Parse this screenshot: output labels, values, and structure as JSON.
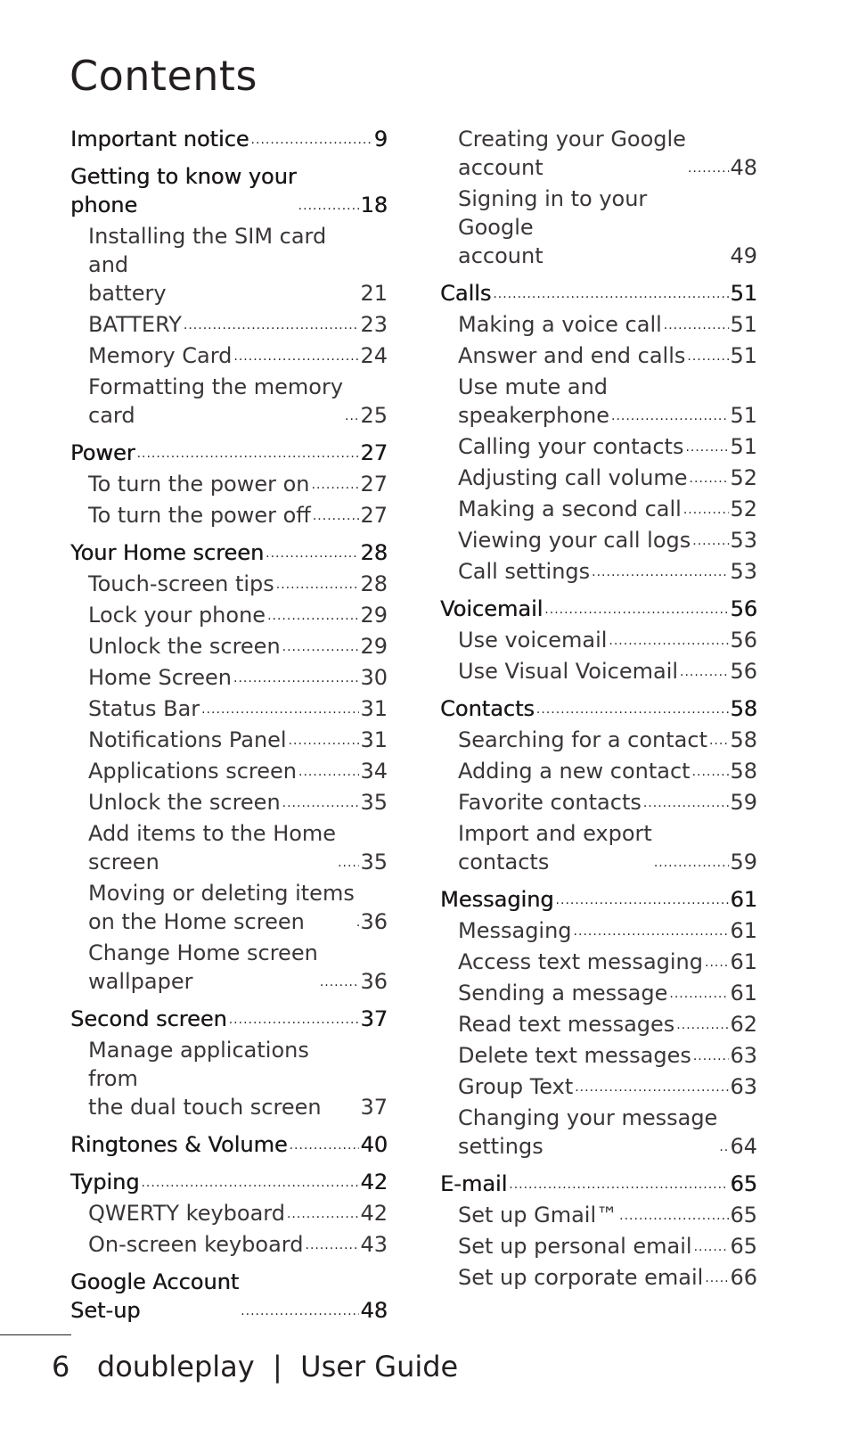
{
  "title": "Contents",
  "left_column": [
    {
      "level": "section",
      "text": "Important notice",
      "page": "9"
    },
    {
      "level": "section",
      "text": "Getting to know your\nphone",
      "page": "18"
    },
    {
      "level": "sub",
      "text": "Installing the SIM card and\nbattery",
      "page": "21"
    },
    {
      "level": "sub",
      "text": "BATTERY",
      "page": "23"
    },
    {
      "level": "sub",
      "text": "Memory Card",
      "page": "24"
    },
    {
      "level": "sub",
      "text": "Formatting the memory\ncard",
      "page": "25"
    },
    {
      "level": "section",
      "text": "Power",
      "page": "27"
    },
    {
      "level": "sub",
      "text": "To turn the power on",
      "page": "27"
    },
    {
      "level": "sub",
      "text": "To turn the power off",
      "page": "27"
    },
    {
      "level": "section",
      "text": "Your Home screen",
      "page": "28"
    },
    {
      "level": "sub",
      "text": "Touch-screen tips",
      "page": "28"
    },
    {
      "level": "sub",
      "text": "Lock your phone",
      "page": "29"
    },
    {
      "level": "sub",
      "text": "Unlock the screen",
      "page": "29"
    },
    {
      "level": "sub",
      "text": "Home Screen",
      "page": "30"
    },
    {
      "level": "sub",
      "text": "Status Bar",
      "page": "31"
    },
    {
      "level": "sub",
      "text": "Notifications Panel",
      "page": "31"
    },
    {
      "level": "sub",
      "text": "Applications screen",
      "page": "34"
    },
    {
      "level": "sub",
      "text": "Unlock the screen",
      "page": "35"
    },
    {
      "level": "sub",
      "text": "Add items to the Home\nscreen",
      "page": "35"
    },
    {
      "level": "sub",
      "text": "Moving or deleting items\non the Home screen",
      "page": "36"
    },
    {
      "level": "sub",
      "text": "Change Home screen\nwallpaper",
      "page": "36"
    },
    {
      "level": "section",
      "text": "Second screen",
      "page": "37"
    },
    {
      "level": "sub",
      "text": "Manage applications from\nthe dual touch screen",
      "page": "37"
    },
    {
      "level": "section",
      "text": "Ringtones & Volume",
      "page": "40"
    },
    {
      "level": "section",
      "text": "Typing",
      "page": "42"
    },
    {
      "level": "sub",
      "text": "QWERTY keyboard",
      "page": "42"
    },
    {
      "level": "sub",
      "text": "On-screen keyboard",
      "page": "43"
    },
    {
      "level": "section",
      "text": "Google Account\nSet-up",
      "page": "48"
    }
  ],
  "right_column": [
    {
      "level": "sub",
      "text": "Creating your Google\naccount",
      "page": "48"
    },
    {
      "level": "sub",
      "text": "Signing in to your Google\naccount",
      "page": "49"
    },
    {
      "level": "section",
      "text": "Calls",
      "page": "51"
    },
    {
      "level": "sub",
      "text": "Making a voice call",
      "page": "51"
    },
    {
      "level": "sub",
      "text": "Answer and end calls",
      "page": "51"
    },
    {
      "level": "sub",
      "text": "Use mute and\nspeakerphone",
      "page": "51"
    },
    {
      "level": "sub",
      "text": "Calling your contacts",
      "page": "51"
    },
    {
      "level": "sub",
      "text": "Adjusting call volume",
      "page": "52"
    },
    {
      "level": "sub",
      "text": "Making a second call",
      "page": "52"
    },
    {
      "level": "sub",
      "text": "Viewing your call logs",
      "page": "53"
    },
    {
      "level": "sub",
      "text": "Call settings",
      "page": "53"
    },
    {
      "level": "section",
      "text": "Voicemail",
      "page": "56"
    },
    {
      "level": "sub",
      "text": "Use voicemail",
      "page": "56"
    },
    {
      "level": "sub",
      "text": "Use Visual Voicemail",
      "page": "56"
    },
    {
      "level": "section",
      "text": "Contacts",
      "page": "58"
    },
    {
      "level": "sub",
      "text": "Searching for a contact",
      "page": "58"
    },
    {
      "level": "sub",
      "text": "Adding a new contact",
      "page": "58"
    },
    {
      "level": "sub",
      "text": "Favorite contacts",
      "page": "59"
    },
    {
      "level": "sub",
      "text": "Import and export\ncontacts",
      "page": "59"
    },
    {
      "level": "section",
      "text": "Messaging",
      "page": "61"
    },
    {
      "level": "sub",
      "text": "Messaging",
      "page": "61"
    },
    {
      "level": "sub",
      "text": "Access text messaging",
      "page": "61"
    },
    {
      "level": "sub",
      "text": "Sending a message",
      "page": "61"
    },
    {
      "level": "sub",
      "text": "Read text messages",
      "page": "62"
    },
    {
      "level": "sub",
      "text": "Delete text messages",
      "page": "63"
    },
    {
      "level": "sub",
      "text": "Group Text",
      "page": "63"
    },
    {
      "level": "sub",
      "text": "Changing your message\nsettings",
      "page": "64"
    },
    {
      "level": "section",
      "text": "E-mail",
      "page": "65"
    },
    {
      "level": "sub",
      "text": "Set up Gmail™",
      "page": "65"
    },
    {
      "level": "sub",
      "text": "Set up personal email",
      "page": "65"
    },
    {
      "level": "sub",
      "text": "Set up corporate email",
      "page": "66"
    }
  ],
  "footer": {
    "page_number": "6",
    "product": "doubleplay",
    "separator": "|",
    "doc_title": "User Guide"
  }
}
